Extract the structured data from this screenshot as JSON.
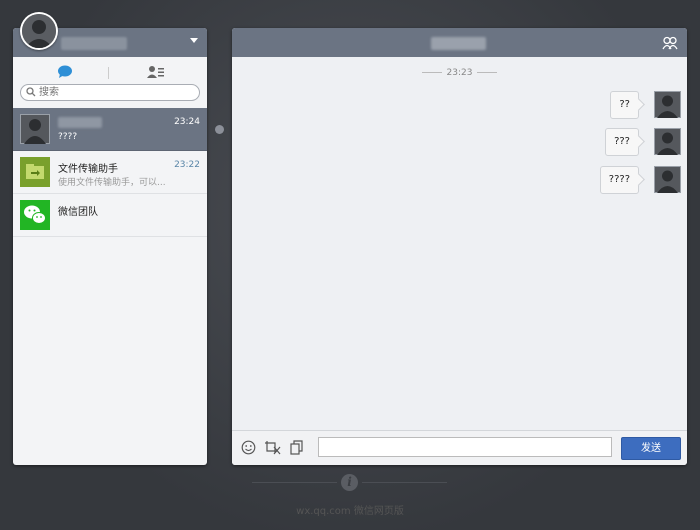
{
  "sidebar": {
    "tabs": [
      "chat",
      "contacts"
    ],
    "search": {
      "placeholder": "搜索",
      "value": ""
    },
    "conversations": [
      {
        "name": "",
        "preview": "????",
        "time": "23:24",
        "active": true,
        "avatar": "gray-person"
      },
      {
        "name": "文件传输助手",
        "preview": "使用文件传输助手，可以...",
        "time": "23:22",
        "active": false,
        "avatar": "file-transfer"
      },
      {
        "name": "微信团队",
        "preview": "",
        "time": "",
        "active": false,
        "avatar": "wechat-logo"
      }
    ]
  },
  "chat": {
    "timestamp": "23:23",
    "messages": [
      {
        "text": "??"
      },
      {
        "text": "???"
      },
      {
        "text": "????"
      }
    ],
    "composer": {
      "value": "",
      "send_label": "发送"
    }
  },
  "footer": {
    "text": "wx.qq.com  微信网页版"
  },
  "colors": {
    "header": "#6b7483",
    "send_button": "#3d6dbf",
    "background": "#3a3d42"
  }
}
